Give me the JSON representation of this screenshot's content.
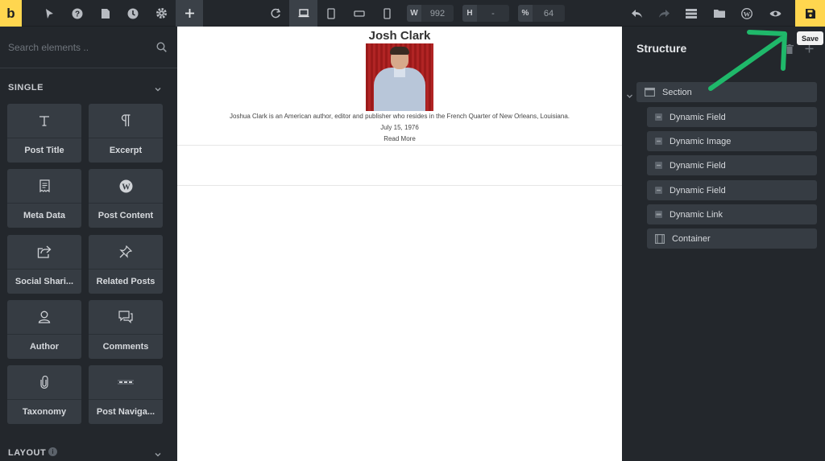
{
  "toolbar": {
    "logo": "b",
    "width_label": "W",
    "width_value": "992",
    "height_label": "H",
    "height_value": "-",
    "zoom_label": "%",
    "zoom_value": "64",
    "save_tooltip": "Save"
  },
  "left_panel": {
    "search_placeholder": "Search elements ..",
    "group_single": "SINGLE",
    "group_layout": "LAYOUT",
    "elements": [
      {
        "label": "Post Title",
        "icon": "text-T-icon"
      },
      {
        "label": "Excerpt",
        "icon": "pilcrow-icon"
      },
      {
        "label": "Meta Data",
        "icon": "receipt-icon"
      },
      {
        "label": "Post Content",
        "icon": "wordpress-icon"
      },
      {
        "label": "Social Shari...",
        "icon": "share-icon"
      },
      {
        "label": "Related Posts",
        "icon": "pin-icon"
      },
      {
        "label": "Author",
        "icon": "user-icon"
      },
      {
        "label": "Comments",
        "icon": "comments-icon"
      },
      {
        "label": "Taxonomy",
        "icon": "paperclip-icon"
      },
      {
        "label": "Post Naviga...",
        "icon": "dots-icon"
      }
    ]
  },
  "canvas": {
    "title": "Josh Clark",
    "excerpt": "Joshua Clark is an American author, editor and publisher who resides in the French Quarter of New Orleans, Louisiana.",
    "date": "July 15, 1976",
    "read_more": "Read More"
  },
  "structure": {
    "title": "Structure",
    "section": "Section",
    "children": [
      "Dynamic Field",
      "Dynamic Image",
      "Dynamic Field",
      "Dynamic Field",
      "Dynamic Link",
      "Container"
    ]
  },
  "colors": {
    "accent": "#ffd64f",
    "arrow": "#1fb86a",
    "panel_bg": "#23272c"
  }
}
